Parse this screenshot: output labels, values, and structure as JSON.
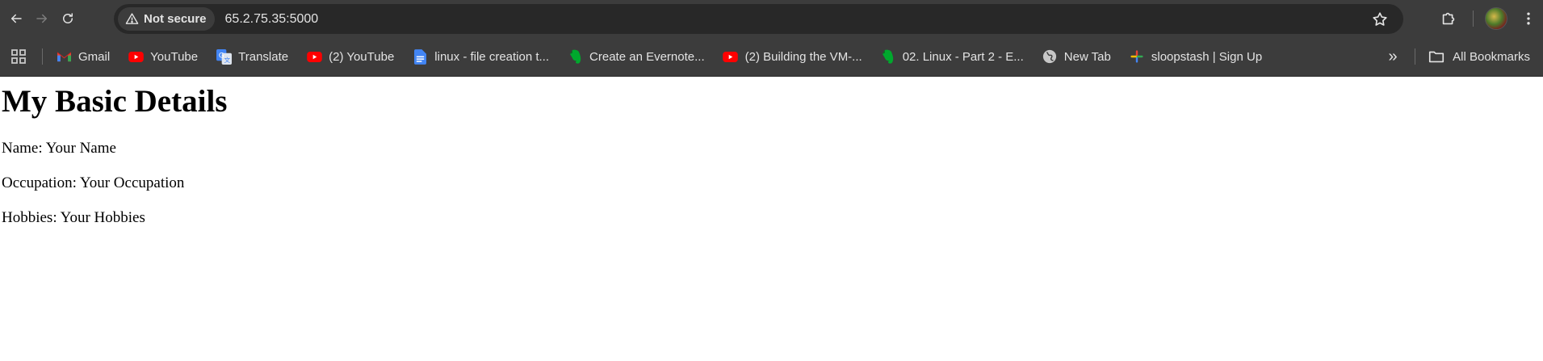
{
  "browser": {
    "security_label": "Not secure",
    "url": "65.2.75.35:5000",
    "icons": {
      "back": "arrow-left-icon",
      "forward": "arrow-right-icon",
      "reload": "reload-icon",
      "security": "warning-triangle-icon",
      "star": "star-icon",
      "extensions": "puzzle-icon",
      "menu": "kebab-menu-icon"
    },
    "colors": {
      "toolbar_bg": "#3c3c3c",
      "omnibox_bg": "#282828",
      "text": "#e3e3e3"
    }
  },
  "bookmarks": {
    "items": [
      {
        "label": "Gmail",
        "icon": "gmail-icon"
      },
      {
        "label": "YouTube",
        "icon": "youtube-icon"
      },
      {
        "label": "Translate",
        "icon": "translate-icon"
      },
      {
        "label": "(2) YouTube",
        "icon": "youtube-icon"
      },
      {
        "label": "linux - file creation t...",
        "icon": "google-docs-icon"
      },
      {
        "label": "Create an Evernote...",
        "icon": "evernote-icon"
      },
      {
        "label": "(2) Building the VM-...",
        "icon": "youtube-icon"
      },
      {
        "label": "02. Linux - Part 2 - E...",
        "icon": "evernote-icon"
      },
      {
        "label": "New Tab",
        "icon": "globe-icon"
      },
      {
        "label": "sloopstash | Sign Up",
        "icon": "sloopstash-icon"
      }
    ],
    "all_bookmarks_label": "All Bookmarks",
    "overflow_glyph": "»"
  },
  "page": {
    "title": "My Basic Details",
    "lines": [
      "Name: Your Name",
      "Occupation: Your Occupation",
      "Hobbies: Your Hobbies"
    ]
  }
}
